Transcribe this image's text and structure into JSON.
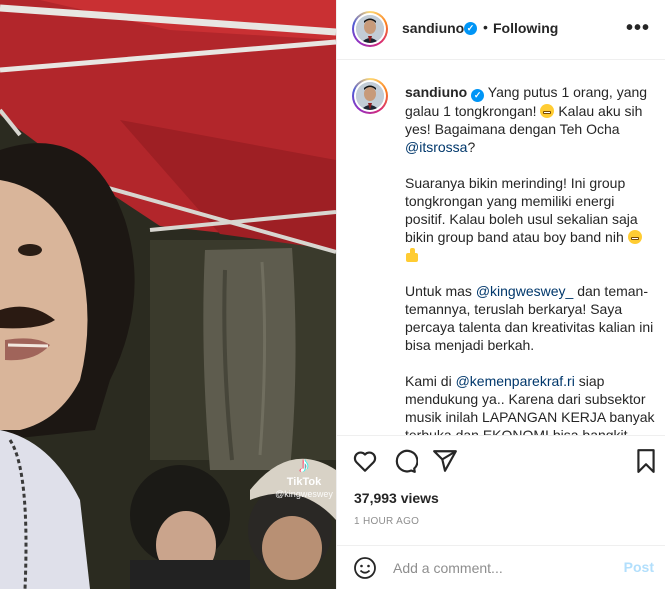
{
  "media": {
    "watermark": {
      "logo": "TikTok",
      "handle": "@kingweswey"
    }
  },
  "header": {
    "username": "sandiuno",
    "separator": "•",
    "follow_status": "Following",
    "more_icon": "more-horizontal-icon"
  },
  "caption": {
    "username": "sandiuno",
    "p1_text": "Yang putus 1 orang, yang galau 1 tongkrongan!",
    "p1_text2": "Kalau aku sih yes! Bagaimana dengan Teh Ocha",
    "p1_mention": "@itsrossa",
    "p1_end": "?",
    "p2_text": "Suaranya bikin merinding! Ini group tongkrongan yang memiliki energi positif. Kalau boleh usul sekalian saja bikin group band atau boy band nih",
    "p3_start": "Untuk mas",
    "p3_mention": "@kingweswey_",
    "p3_rest": "dan teman-temannya, teruslah berkarya! Saya percaya talenta dan kreativitas kalian ini bisa menjadi berkah.",
    "p4_start": "Kami di",
    "p4_mention": "@kemenparekraf.ri",
    "p4_rest": "siap mendukung ya.. Karena dari subsektor musik inilah LAPANGAN KERJA banyak terbuka dan EKONOMI bisa bangkit."
  },
  "actions": {
    "like_icon": "heart-icon",
    "comment_icon": "comment-icon",
    "share_icon": "send-icon",
    "save_icon": "bookmark-icon"
  },
  "stats": {
    "likes": "37,993 views",
    "timestamp": "1 HOUR AGO"
  },
  "comment_box": {
    "placeholder": "Add a comment...",
    "post_label": "Post",
    "emoji_icon": "smiley-icon"
  },
  "colors": {
    "link": "#00376b",
    "verified": "#0095f6",
    "post_disabled": "#b2dffc",
    "muted": "#8e8e8e"
  }
}
